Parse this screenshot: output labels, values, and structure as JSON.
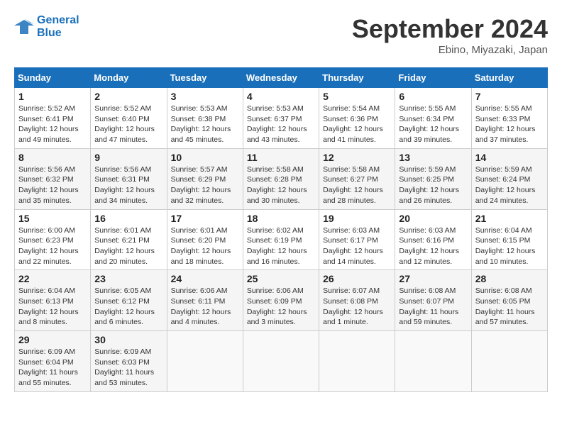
{
  "header": {
    "logo_line1": "General",
    "logo_line2": "Blue",
    "month_title": "September 2024",
    "location": "Ebino, Miyazaki, Japan"
  },
  "days_of_week": [
    "Sunday",
    "Monday",
    "Tuesday",
    "Wednesday",
    "Thursday",
    "Friday",
    "Saturday"
  ],
  "weeks": [
    [
      {
        "day": "1",
        "sunrise": "5:52 AM",
        "sunset": "6:41 PM",
        "daylight": "12 hours and 49 minutes."
      },
      {
        "day": "2",
        "sunrise": "5:52 AM",
        "sunset": "6:40 PM",
        "daylight": "12 hours and 47 minutes."
      },
      {
        "day": "3",
        "sunrise": "5:53 AM",
        "sunset": "6:38 PM",
        "daylight": "12 hours and 45 minutes."
      },
      {
        "day": "4",
        "sunrise": "5:53 AM",
        "sunset": "6:37 PM",
        "daylight": "12 hours and 43 minutes."
      },
      {
        "day": "5",
        "sunrise": "5:54 AM",
        "sunset": "6:36 PM",
        "daylight": "12 hours and 41 minutes."
      },
      {
        "day": "6",
        "sunrise": "5:55 AM",
        "sunset": "6:34 PM",
        "daylight": "12 hours and 39 minutes."
      },
      {
        "day": "7",
        "sunrise": "5:55 AM",
        "sunset": "6:33 PM",
        "daylight": "12 hours and 37 minutes."
      }
    ],
    [
      {
        "day": "8",
        "sunrise": "5:56 AM",
        "sunset": "6:32 PM",
        "daylight": "12 hours and 35 minutes."
      },
      {
        "day": "9",
        "sunrise": "5:56 AM",
        "sunset": "6:31 PM",
        "daylight": "12 hours and 34 minutes."
      },
      {
        "day": "10",
        "sunrise": "5:57 AM",
        "sunset": "6:29 PM",
        "daylight": "12 hours and 32 minutes."
      },
      {
        "day": "11",
        "sunrise": "5:58 AM",
        "sunset": "6:28 PM",
        "daylight": "12 hours and 30 minutes."
      },
      {
        "day": "12",
        "sunrise": "5:58 AM",
        "sunset": "6:27 PM",
        "daylight": "12 hours and 28 minutes."
      },
      {
        "day": "13",
        "sunrise": "5:59 AM",
        "sunset": "6:25 PM",
        "daylight": "12 hours and 26 minutes."
      },
      {
        "day": "14",
        "sunrise": "5:59 AM",
        "sunset": "6:24 PM",
        "daylight": "12 hours and 24 minutes."
      }
    ],
    [
      {
        "day": "15",
        "sunrise": "6:00 AM",
        "sunset": "6:23 PM",
        "daylight": "12 hours and 22 minutes."
      },
      {
        "day": "16",
        "sunrise": "6:01 AM",
        "sunset": "6:21 PM",
        "daylight": "12 hours and 20 minutes."
      },
      {
        "day": "17",
        "sunrise": "6:01 AM",
        "sunset": "6:20 PM",
        "daylight": "12 hours and 18 minutes."
      },
      {
        "day": "18",
        "sunrise": "6:02 AM",
        "sunset": "6:19 PM",
        "daylight": "12 hours and 16 minutes."
      },
      {
        "day": "19",
        "sunrise": "6:03 AM",
        "sunset": "6:17 PM",
        "daylight": "12 hours and 14 minutes."
      },
      {
        "day": "20",
        "sunrise": "6:03 AM",
        "sunset": "6:16 PM",
        "daylight": "12 hours and 12 minutes."
      },
      {
        "day": "21",
        "sunrise": "6:04 AM",
        "sunset": "6:15 PM",
        "daylight": "12 hours and 10 minutes."
      }
    ],
    [
      {
        "day": "22",
        "sunrise": "6:04 AM",
        "sunset": "6:13 PM",
        "daylight": "12 hours and 8 minutes."
      },
      {
        "day": "23",
        "sunrise": "6:05 AM",
        "sunset": "6:12 PM",
        "daylight": "12 hours and 6 minutes."
      },
      {
        "day": "24",
        "sunrise": "6:06 AM",
        "sunset": "6:11 PM",
        "daylight": "12 hours and 4 minutes."
      },
      {
        "day": "25",
        "sunrise": "6:06 AM",
        "sunset": "6:09 PM",
        "daylight": "12 hours and 3 minutes."
      },
      {
        "day": "26",
        "sunrise": "6:07 AM",
        "sunset": "6:08 PM",
        "daylight": "12 hours and 1 minute."
      },
      {
        "day": "27",
        "sunrise": "6:08 AM",
        "sunset": "6:07 PM",
        "daylight": "11 hours and 59 minutes."
      },
      {
        "day": "28",
        "sunrise": "6:08 AM",
        "sunset": "6:05 PM",
        "daylight": "11 hours and 57 minutes."
      }
    ],
    [
      {
        "day": "29",
        "sunrise": "6:09 AM",
        "sunset": "6:04 PM",
        "daylight": "11 hours and 55 minutes."
      },
      {
        "day": "30",
        "sunrise": "6:09 AM",
        "sunset": "6:03 PM",
        "daylight": "11 hours and 53 minutes."
      },
      null,
      null,
      null,
      null,
      null
    ]
  ]
}
